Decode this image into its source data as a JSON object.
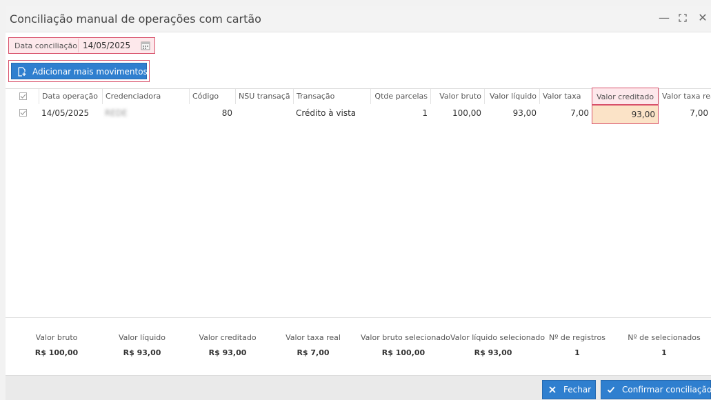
{
  "window": {
    "title": "Conciliação manual de operações com cartão",
    "minimize_glyph": "—",
    "maximize_glyph": "⛶",
    "close_glyph": "✕"
  },
  "filter": {
    "date_label": "Data conciliação",
    "date_value": "14/05/2025"
  },
  "toolbar": {
    "add_label": "Adicionar mais movimentos"
  },
  "table": {
    "headers": [
      "Data operação",
      "Credenciadora",
      "Código",
      "NSU transaçã",
      "Transação",
      "Qtde parcelas",
      "Valor bruto",
      "Valor líquido",
      "Valor taxa",
      "Valor creditado",
      "Valor taxa real"
    ],
    "rows": [
      {
        "data_operacao": "14/05/2025",
        "credenciadora": "REDE",
        "codigo": "80",
        "nsu": "",
        "transacao": "Crédito à vista",
        "qtde_parcelas": "1",
        "valor_bruto": "100,00",
        "valor_liquido": "93,00",
        "valor_taxa": "7,00",
        "valor_creditado": "93,00",
        "valor_taxa_real": "7,00"
      }
    ]
  },
  "summary": [
    {
      "label": "Valor bruto",
      "value": "R$ 100,00"
    },
    {
      "label": "Valor líquido",
      "value": "R$ 93,00"
    },
    {
      "label": "Valor creditado",
      "value": "R$ 93,00"
    },
    {
      "label": "Valor taxa real",
      "value": "R$ 7,00"
    },
    {
      "label": "Valor bruto selecionado",
      "value": "R$ 100,00"
    },
    {
      "label": "Valor líquido selecionado",
      "value": "R$ 93,00"
    },
    {
      "label": "Nº de registros",
      "value": "1"
    },
    {
      "label": "Nº de selecionados",
      "value": "1"
    }
  ],
  "actions": {
    "close_label": "Fechar",
    "confirm_label": "Confirmar conciliação"
  },
  "colors": {
    "primary": "#2f7fcf",
    "highlight_border": "#d8506a",
    "highlight_fill": "#fde8eb",
    "edited_cell": "#fbe3c7"
  }
}
